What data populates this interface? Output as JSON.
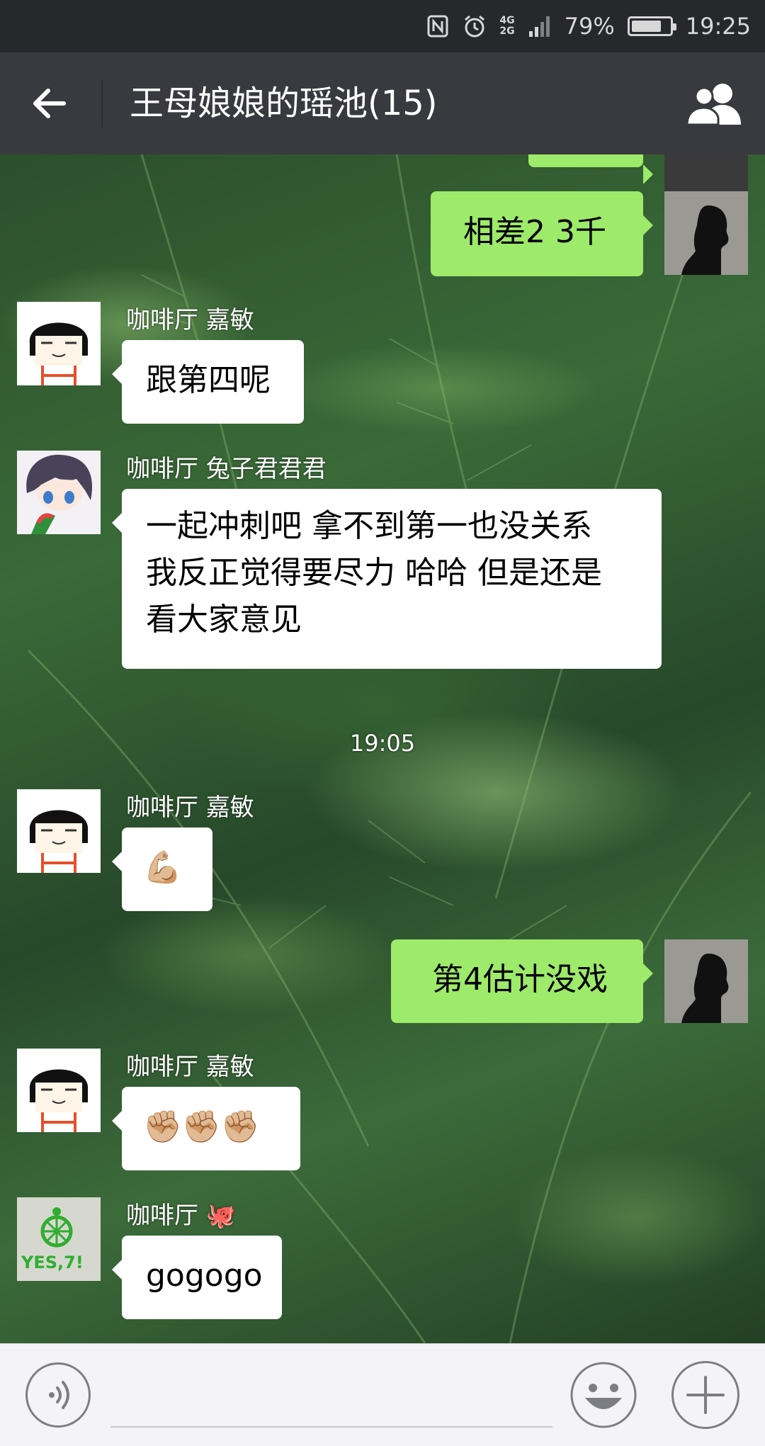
{
  "status_bar": {
    "network_top": "4G",
    "network_bottom": "2G",
    "battery_percent": "79%",
    "battery_level": 0.79,
    "time": "19:25",
    "icons": [
      "nfc-icon",
      "alarm-icon",
      "signal-icon",
      "battery-icon"
    ]
  },
  "header": {
    "title": "王母娘娘的瑶池(15)",
    "back_icon": "arrow-left-icon",
    "members_icon": "group-members-icon"
  },
  "messages": [
    {
      "direction": "out",
      "text": "相差2 3千"
    },
    {
      "direction": "in",
      "sender": "咖啡厅 嘉敏",
      "text": "跟第四呢"
    },
    {
      "direction": "in",
      "sender": "咖啡厅 兔子君君君",
      "lines": [
        "一起冲刺吧 拿不到第一也没关系",
        "我反正觉得要尽力 哈哈 但是还是",
        "看大家意见"
      ]
    },
    {
      "type": "timestamp",
      "text": "19:05"
    },
    {
      "direction": "in",
      "sender": "咖啡厅 嘉敏",
      "text": "💪🏼"
    },
    {
      "direction": "out",
      "text": "第4估计没戏"
    },
    {
      "direction": "in",
      "sender": "咖啡厅 嘉敏",
      "text": "✊🏼✊🏼✊🏼"
    },
    {
      "direction": "in",
      "sender": "咖啡厅 🐙",
      "text": "gogogo",
      "avatar_text": "YES,7!"
    }
  ],
  "input_bar": {
    "voice_icon": "voice-icon",
    "emoji_icon": "emoji-icon",
    "plus_icon": "plus-icon"
  },
  "colors": {
    "status_bar": "#26282c",
    "title_bar": "#393a3f",
    "outgoing_bubble": "#9eea6a",
    "incoming_bubble": "#ffffff",
    "input_bar": "#f4f4f6"
  }
}
